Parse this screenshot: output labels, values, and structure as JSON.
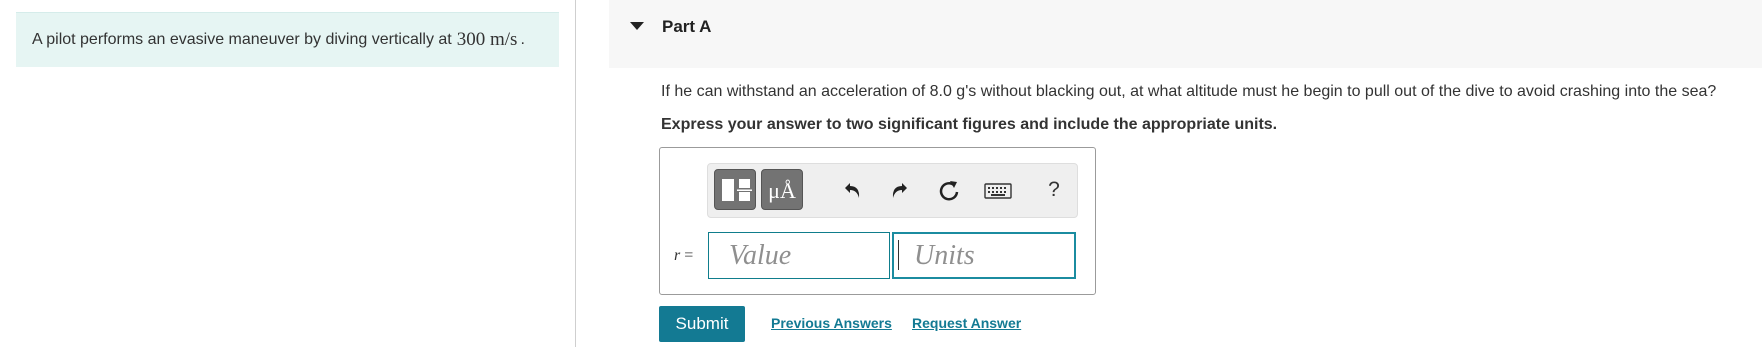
{
  "problem": {
    "text": "A pilot performs an evasive maneuver by diving vertically at",
    "value": "300",
    "unit": "m/s",
    "period": "."
  },
  "part": {
    "title": "Part A",
    "question": "If he can withstand an acceleration of 8.0 g's without blacking out, at what altitude must he begin to pull out of the dive to avoid crashing into the sea?",
    "instruction": "Express your answer to two significant figures and include the appropriate units."
  },
  "toolbar": {
    "units_label": "μÅ",
    "help_label": "?",
    "icons": [
      "templates-icon",
      "units-icon",
      "undo-icon",
      "redo-icon",
      "reset-icon",
      "keyboard-icon",
      "help-icon"
    ]
  },
  "answer": {
    "variable": "r",
    "equals": "=",
    "value_placeholder": "Value",
    "units_placeholder": "Units",
    "value": "",
    "units": ""
  },
  "actions": {
    "submit_label": "Submit",
    "previous_answers_label": "Previous Answers",
    "request_answer_label": "Request Answer"
  },
  "colors": {
    "accent": "#137a93",
    "problem_bg": "#e6f5f3",
    "header_bg": "#f7f7f7"
  }
}
